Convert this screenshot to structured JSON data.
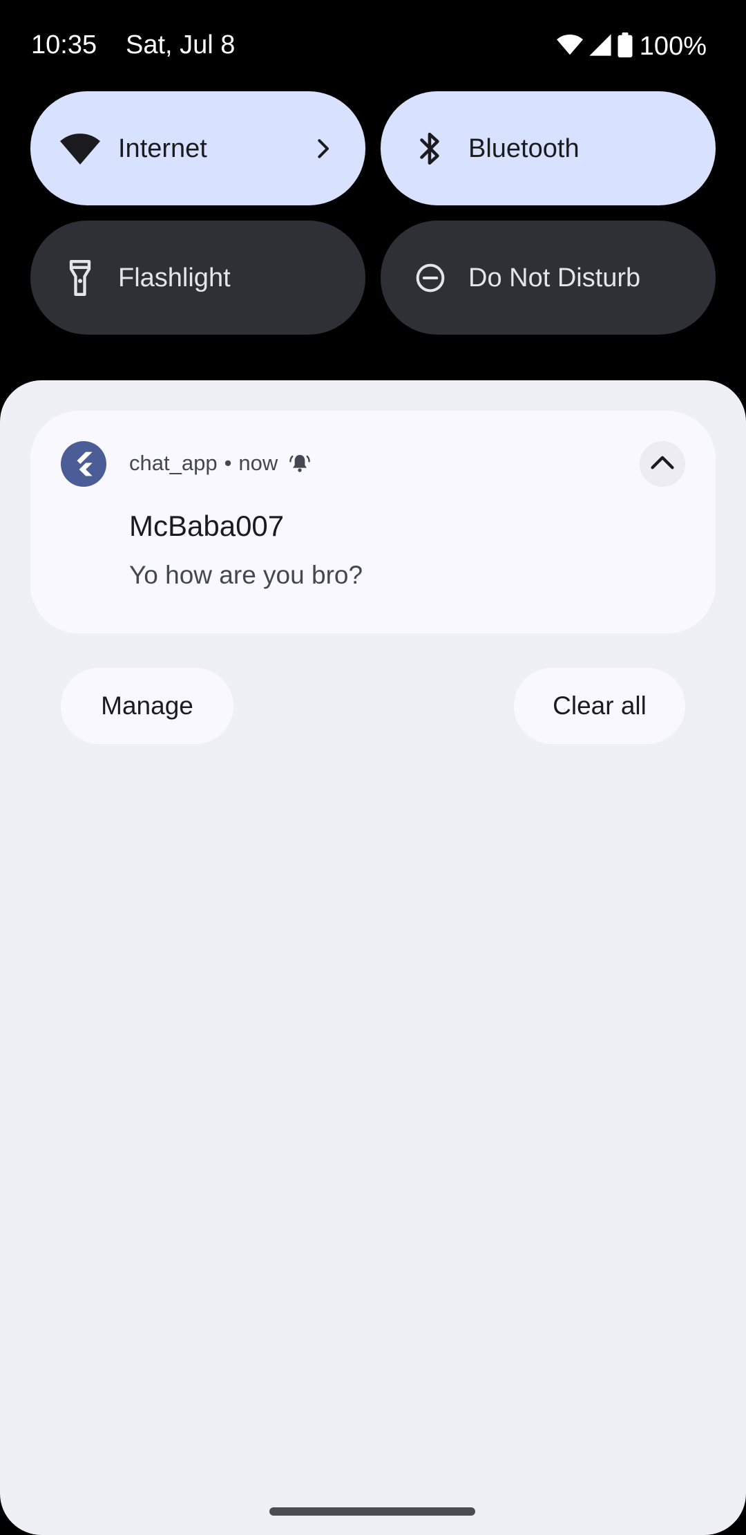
{
  "status_bar": {
    "time": "10:35",
    "date": "Sat, Jul 8",
    "battery": "100%",
    "icons": [
      "wifi-icon",
      "signal-icon",
      "battery-icon"
    ]
  },
  "quick_settings": {
    "tiles": [
      {
        "label": "Internet",
        "icon": "wifi-icon",
        "state": "on",
        "has_chevron": true
      },
      {
        "label": "Bluetooth",
        "icon": "bluetooth-icon",
        "state": "on"
      },
      {
        "label": "Flashlight",
        "icon": "flashlight-icon",
        "state": "off"
      },
      {
        "label": "Do Not Disturb",
        "icon": "do-not-disturb-icon",
        "state": "off"
      }
    ]
  },
  "notification": {
    "app_name": "chat_app",
    "separator": "•",
    "time": "now",
    "title": "McBaba007",
    "text": "Yo how are you bro?",
    "app_icon": "flutter-icon",
    "alert_icon": "bell-ringing-icon",
    "expand_icon": "chevron-up-icon"
  },
  "actions": {
    "manage": "Manage",
    "clear_all": "Clear all"
  },
  "colors": {
    "tile_on": "#d8e2ff",
    "tile_off": "#2f3036",
    "shade_bg": "#efeff6",
    "card_bg": "#f8f8fe",
    "app_icon_bg": "#4a5d97"
  }
}
